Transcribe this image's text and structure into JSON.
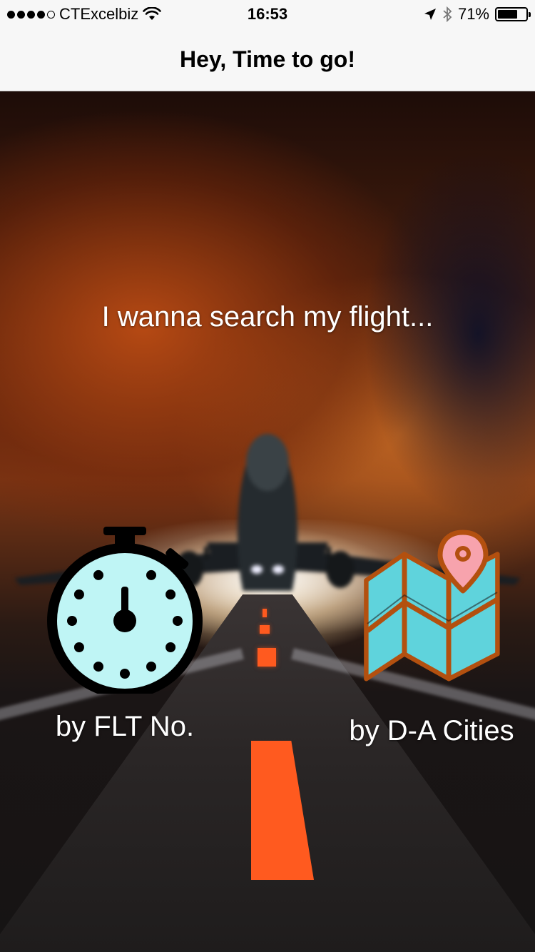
{
  "status_bar": {
    "carrier": "CTExcelbiz",
    "time": "16:53",
    "battery_percent": "71%",
    "battery_level": 0.71,
    "signal_bars_filled": 4,
    "signal_bars_total": 5,
    "icons": [
      "wifi-icon",
      "location-arrow-icon",
      "bluetooth-icon",
      "battery-icon"
    ]
  },
  "nav": {
    "title": "Hey, Time to go!"
  },
  "main": {
    "headline": "I wanna search my flight...",
    "options": [
      {
        "label": "by FLT No.",
        "icon": "stopwatch-icon"
      },
      {
        "label": "by D-A Cities",
        "icon": "map-pin-icon"
      }
    ]
  },
  "colors": {
    "stopwatch_face": "#bff5f5",
    "map_fill": "#5fd3dc",
    "map_outline": "#b3500f",
    "pin_fill": "#f7a3ad",
    "runway_marking": "#ff5a1f"
  }
}
